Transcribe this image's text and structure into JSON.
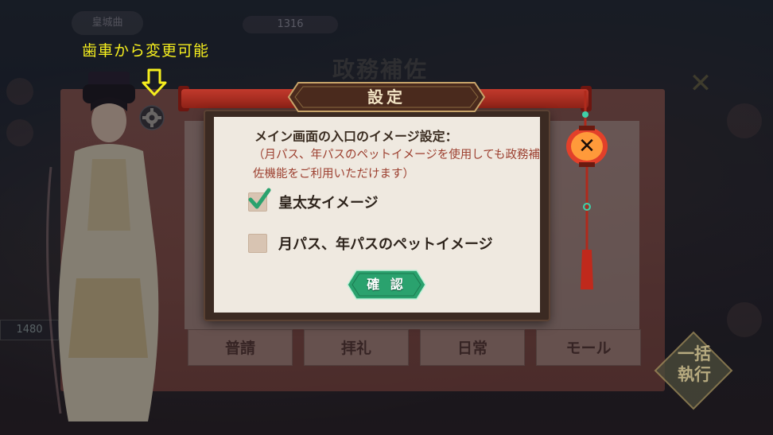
{
  "background": {
    "top_name": "皇城曲",
    "top_counter": "1316",
    "side_number": "1480",
    "panel_title": "政務補佐",
    "panel_tabs": [
      "普請",
      "拝礼",
      "日常",
      "モール"
    ],
    "action_button": "一括執行"
  },
  "annotation": {
    "text": "歯車から変更可能",
    "color": "#f5ee1e"
  },
  "dialog": {
    "title": "設定",
    "heading": "メイン画面の入口のイメージ設定：",
    "note": "（月パス、年パスのペットイメージを使用しても政務補佐機能をご利用いただけます）",
    "options": [
      {
        "label": "皇太女イメージ",
        "checked": true
      },
      {
        "label": "月パス、年パスのペットイメージ",
        "checked": false
      }
    ],
    "confirm_label": "確 認"
  },
  "colors": {
    "accent_green": "#2aa26e",
    "note_red": "#9c3f2f",
    "ribbon_red": "#c23a2c"
  },
  "icons": [
    "gear-icon",
    "down-arrow-icon",
    "close-icon",
    "checkmark-icon",
    "lantern-close-icon"
  ]
}
